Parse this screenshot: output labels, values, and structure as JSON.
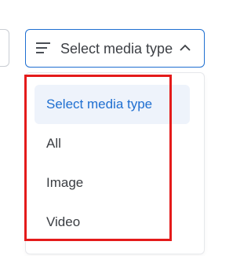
{
  "media_select": {
    "trigger_label": "Select media type",
    "icons": {
      "leading": "filter-lines-icon",
      "trailing": "chevron-up-icon"
    },
    "options": [
      {
        "label": "Select media type",
        "selected": true
      },
      {
        "label": "All",
        "selected": false
      },
      {
        "label": "Image",
        "selected": false
      },
      {
        "label": "Video",
        "selected": false
      }
    ]
  },
  "colors": {
    "accent": "#1f6fd1",
    "selected_bg": "#eef3fb",
    "highlight": "#e41b1b"
  }
}
